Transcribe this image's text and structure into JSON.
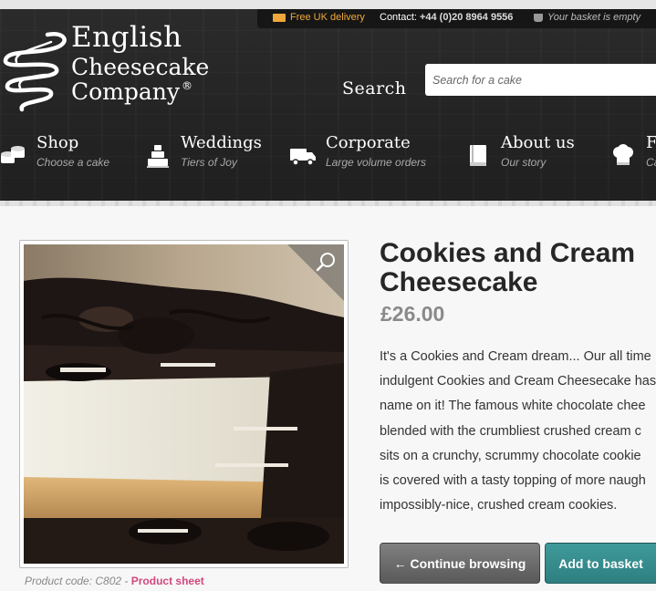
{
  "utility_bar": {
    "delivery": "Free UK delivery",
    "contact_label": "Contact:",
    "contact_phone": "+44 (0)20 8964 9556",
    "basket_status": "Your basket is empty"
  },
  "logo": {
    "line1": "English",
    "line2": "Cheesecake",
    "line3": "Company",
    "reg": "®"
  },
  "search": {
    "label": "Search",
    "placeholder": "Search for a cake"
  },
  "nav": {
    "items": [
      {
        "title": "Shop",
        "subtitle": "Choose a cake",
        "icon": "cakes-icon"
      },
      {
        "title": "Weddings",
        "subtitle": "Tiers of Joy",
        "icon": "tiered-cake-icon"
      },
      {
        "title": "Corporate",
        "subtitle": "Large volume orders",
        "icon": "delivery-truck-icon"
      },
      {
        "title": "About us",
        "subtitle": "Our story",
        "icon": "book-icon"
      },
      {
        "title": "F",
        "subtitle": "Ca",
        "icon": "chef-hat-icon"
      }
    ]
  },
  "product": {
    "title": "Cookies and Cream Cheesecake",
    "price": "£26.00",
    "description_lines": [
      "It's a Cookies and Cream dream... Our all time",
      "indulgent Cookies and Cream Cheesecake has",
      "name on it! The famous white chocolate chee",
      "blended with the crumbliest crushed cream c",
      "sits on a crunchy, scrummy chocolate cookie",
      "is covered with a tasty topping of more naugh",
      "impossibly-nice, crushed cream cookies."
    ],
    "code_label": "Product code: C802 -",
    "sheet_link": "Product sheet",
    "continue_button": "← Continue browsing",
    "add_button": "Add to basket"
  },
  "colors": {
    "header_bg": "#262626",
    "accent_orange": "#f0a83a",
    "teal": "#2e8384",
    "grey_button": "#6b6b6b",
    "link_pink": "#d2477e"
  }
}
